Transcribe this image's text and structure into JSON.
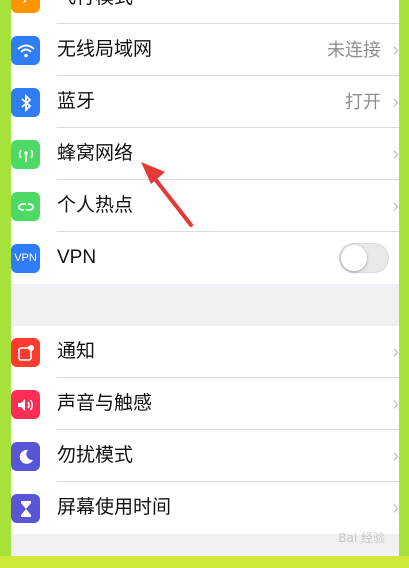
{
  "colors": {
    "frame_bg": "#efeff4",
    "wifi": "#2f7cf6",
    "bluetooth": "#2f7cf6",
    "cellular": "#4cd964",
    "hotspot": "#4cd964",
    "vpn": "#2f7cf6",
    "notifications": "#ff3b30",
    "sounds": "#ff2d55",
    "dnd": "#5856d6",
    "screentime": "#5856d6",
    "arrow": "#e53935"
  },
  "partial_top": {
    "label": "飞行模式",
    "icon": "airplane-icon"
  },
  "group1": {
    "items": [
      {
        "id": "wifi",
        "label": "无线局域网",
        "value": "未连接",
        "icon": "wifi-icon"
      },
      {
        "id": "bluetooth",
        "label": "蓝牙",
        "value": "打开",
        "icon": "bluetooth-icon"
      },
      {
        "id": "cellular",
        "label": "蜂窝网络",
        "value": "",
        "icon": "antenna-icon"
      },
      {
        "id": "hotspot",
        "label": "个人热点",
        "value": "",
        "icon": "hotspot-icon"
      },
      {
        "id": "vpn",
        "label": "VPN",
        "icon_text": "VPN",
        "icon": "vpn-icon"
      }
    ]
  },
  "group2": {
    "items": [
      {
        "id": "notifications",
        "label": "通知",
        "icon": "notification-icon"
      },
      {
        "id": "sounds",
        "label": "声音与触感",
        "icon": "speaker-icon"
      },
      {
        "id": "dnd",
        "label": "勿扰模式",
        "icon": "moon-icon"
      },
      {
        "id": "screentime",
        "label": "屏幕使用时间",
        "icon": "hourglass-icon"
      }
    ]
  },
  "chevron": "›",
  "watermark": "Bai 经验"
}
